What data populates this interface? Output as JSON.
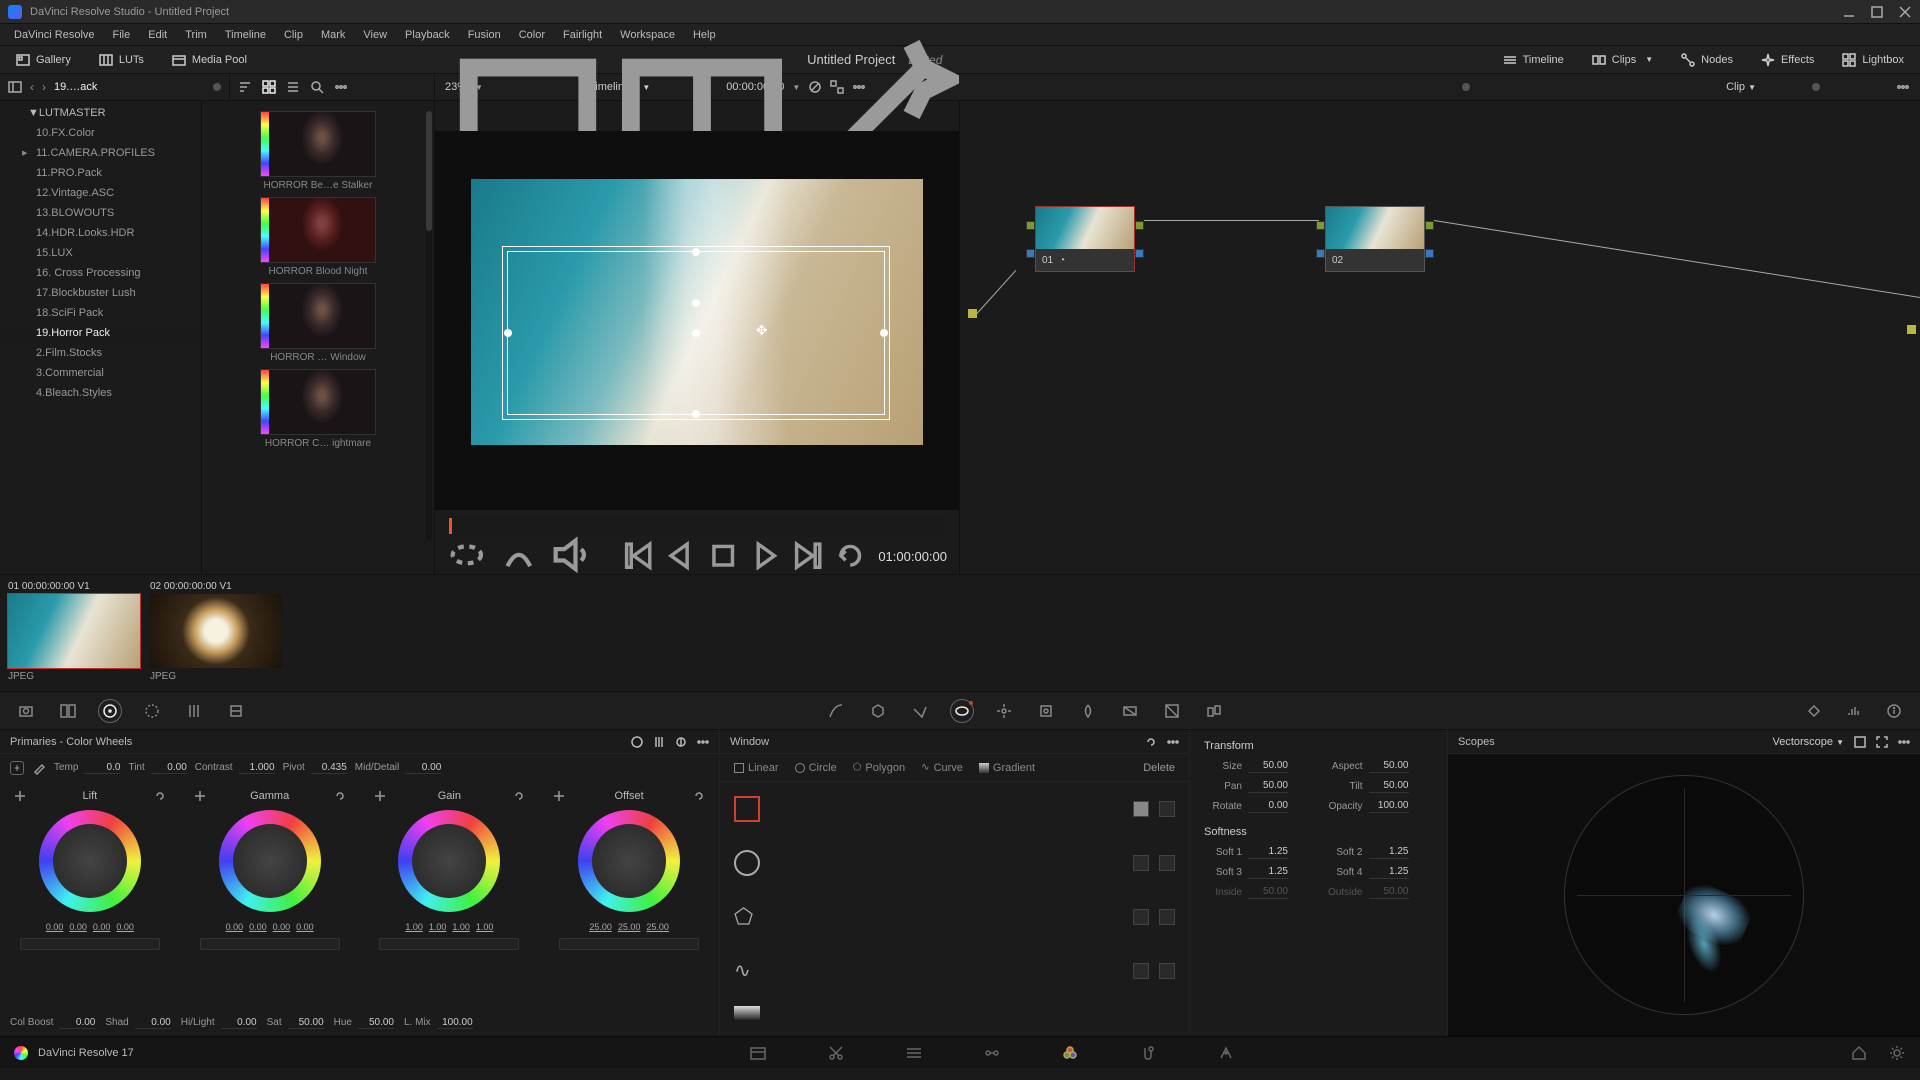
{
  "titlebar": {
    "title": "DaVinci Resolve Studio - Untitled Project"
  },
  "menubar": [
    "DaVinci Resolve",
    "File",
    "Edit",
    "Trim",
    "Timeline",
    "Clip",
    "Mark",
    "View",
    "Playback",
    "Fusion",
    "Color",
    "Fairlight",
    "Workspace",
    "Help"
  ],
  "topbar": {
    "gallery": "Gallery",
    "luts": "LUTs",
    "mediapool": "Media Pool",
    "project": "Untitled Project",
    "edited": "Edited",
    "timeline": "Timeline",
    "clips": "Clips",
    "nodes": "Nodes",
    "effects": "Effects",
    "lightbox": "Lightbox"
  },
  "subbar": {
    "breadcrumb": "19.…ack",
    "zoom": "23%",
    "timeline_name": "Timeline 1",
    "tc": "00:00:00:00",
    "clip": "Clip"
  },
  "folders": [
    "LUTMASTER",
    "10.FX.Color",
    "11.CAMERA.PROFILES",
    "11.PRO.Pack",
    "12.Vintage.ASC",
    "13.BLOWOUTS",
    "14.HDR.Looks.HDR",
    "15.LUX",
    "16. Cross Processing",
    "17.Blockbuster Lush",
    "18.SciFi Pack",
    "19.Horror Pack",
    "2.Film.Stocks",
    "3.Commercial",
    "4.Bleach.Styles"
  ],
  "folder_selected": 11,
  "lut_thumbs": [
    "HORROR Be…e Stalker",
    "HORROR Blood Night",
    "HORROR … Window",
    "HORROR C… ightmare"
  ],
  "viewer": {
    "tc": "01:00:00:00"
  },
  "nodes": [
    {
      "label": "01",
      "sel": true,
      "has_icon": true
    },
    {
      "label": "02",
      "sel": false,
      "has_icon": false
    }
  ],
  "clips": [
    {
      "head": "01   00:00:00:00   V1",
      "fmt": "JPEG",
      "sel": true,
      "bg": "linear-gradient(115deg,#1a7a8a 0%,#2a9aaa 30%,#e8e4d4 55%,#b8a074 100%)"
    },
    {
      "head": "02   00:00:00:00   V1",
      "fmt": "JPEG",
      "sel": false,
      "bg": "radial-gradient(circle at 50% 50%, #f5f0e0 15%, #caa060 28%, #3a2a18 45%, #1a120a 100%)"
    }
  ],
  "primaries": {
    "title": "Primaries - Color Wheels",
    "temp": {
      "lbl": "Temp",
      "val": "0.0"
    },
    "tint": {
      "lbl": "Tint",
      "val": "0.00"
    },
    "contrast": {
      "lbl": "Contrast",
      "val": "1.000"
    },
    "pivot": {
      "lbl": "Pivot",
      "val": "0.435"
    },
    "middetail": {
      "lbl": "Mid/Detail",
      "val": "0.00"
    },
    "wheels": [
      {
        "name": "Lift",
        "vals": [
          "0.00",
          "0.00",
          "0.00",
          "0.00"
        ]
      },
      {
        "name": "Gamma",
        "vals": [
          "0.00",
          "0.00",
          "0.00",
          "0.00"
        ]
      },
      {
        "name": "Gain",
        "vals": [
          "1.00",
          "1.00",
          "1.00",
          "1.00"
        ]
      },
      {
        "name": "Offset",
        "vals": [
          "25.00",
          "25.00",
          "25.00"
        ]
      }
    ],
    "colboost": {
      "lbl": "Col Boost",
      "val": "0.00"
    },
    "shad": {
      "lbl": "Shad",
      "val": "0.00"
    },
    "hilight": {
      "lbl": "Hi/Light",
      "val": "0.00"
    },
    "sat": {
      "lbl": "Sat",
      "val": "50.00"
    },
    "hue": {
      "lbl": "Hue",
      "val": "50.00"
    },
    "lmix": {
      "lbl": "L. Mix",
      "val": "100.00"
    }
  },
  "window": {
    "title": "Window",
    "tabs": [
      "Linear",
      "Circle",
      "Polygon",
      "Curve",
      "Gradient"
    ],
    "delete": "Delete"
  },
  "transform": {
    "title": "Transform",
    "size": {
      "lbl": "Size",
      "val": "50.00"
    },
    "aspect": {
      "lbl": "Aspect",
      "val": "50.00"
    },
    "pan": {
      "lbl": "Pan",
      "val": "50.00"
    },
    "tilt": {
      "lbl": "Tilt",
      "val": "50.00"
    },
    "rotate": {
      "lbl": "Rotate",
      "val": "0.00"
    },
    "opacity": {
      "lbl": "Opacity",
      "val": "100.00"
    },
    "soft_title": "Softness",
    "soft1": {
      "lbl": "Soft 1",
      "val": "1.25"
    },
    "soft2": {
      "lbl": "Soft 2",
      "val": "1.25"
    },
    "soft3": {
      "lbl": "Soft 3",
      "val": "1.25"
    },
    "soft4": {
      "lbl": "Soft 4",
      "val": "1.25"
    },
    "inside": {
      "lbl": "Inside",
      "val": "50.00"
    },
    "outside": {
      "lbl": "Outside",
      "val": "50.00"
    }
  },
  "scopes": {
    "title": "Scopes",
    "mode": "Vectorscope"
  },
  "app_version": "DaVinci Resolve 17"
}
